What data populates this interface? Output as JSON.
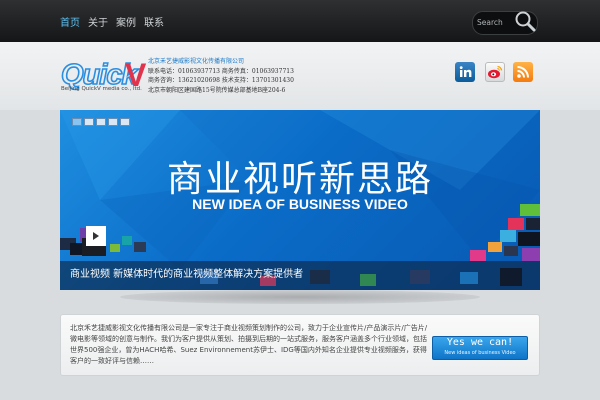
{
  "nav": {
    "items": [
      {
        "label": "首页",
        "active": true
      },
      {
        "label": "关于",
        "active": false
      },
      {
        "label": "案例",
        "active": false
      },
      {
        "label": "联系",
        "active": false
      }
    ]
  },
  "search": {
    "placeholder": "Search"
  },
  "logo": {
    "text": "QuickV",
    "subtitle": "Beijing QuickV media co., ltd."
  },
  "contact": {
    "company": "北京禾艺捷威影视文化传播有限公司",
    "line1": "联系电话：01063937713  商务传真：01063937713",
    "line2": "商务咨询：13621020698  技术支持：13701301430",
    "line3": "北京市朝阳区建国路15号院传媒总部基地B座204-6"
  },
  "social": [
    "linkedin-icon",
    "weibo-icon",
    "rss-icon"
  ],
  "banner": {
    "headline": "商业视听新思路",
    "subline": "NEW IDEA OF BUSINESS VIDEO",
    "caption": "商业视频 新媒体时代的商业视频整体解决方案提供者",
    "slides": 5,
    "active_slide": 0
  },
  "intro": {
    "text": "北京禾艺捷威影视文化传播有限公司是一家专注于商业视频策划制作的公司，致力于企业宣传片/产品演示片/广告片/微电影等领域的创意与制作。我们为客户提供从策划、拍摄到后期的一站式服务，服务客户涵盖多个行业领域，包括世界500强企业，曾为HACH哈希、Suez Environnement苏伊士、IDG等国内外知名企业提供专业视频服务，获得客户的一致好评与信赖……"
  },
  "cta": {
    "label": "Yes we can!",
    "sub": "New ideas of business Video"
  },
  "colors": {
    "accent": "#1a8fe3",
    "nav_active": "#5ec0f0",
    "topbar": "#1d1e20"
  }
}
